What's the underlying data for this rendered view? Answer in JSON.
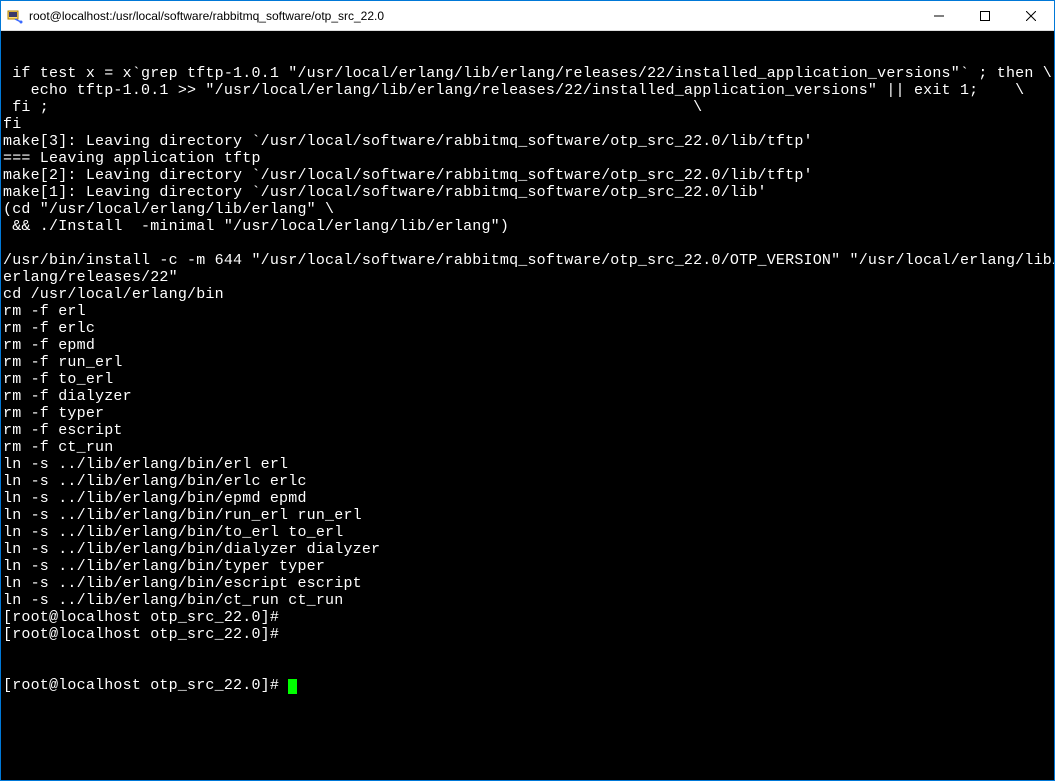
{
  "window": {
    "title": "root@localhost:/usr/local/software/rabbitmq_software/otp_src_22.0"
  },
  "terminal": {
    "lines": [
      " if test x = x`grep tftp-1.0.1 \"/usr/local/erlang/lib/erlang/releases/22/installed_application_versions\"` ; then \\",
      "   echo tftp-1.0.1 >> \"/usr/local/erlang/lib/erlang/releases/22/installed_application_versions\" || exit 1;    \\",
      " fi ;                                                                      \\",
      "fi",
      "make[3]: Leaving directory `/usr/local/software/rabbitmq_software/otp_src_22.0/lib/tftp'",
      "=== Leaving application tftp",
      "make[2]: Leaving directory `/usr/local/software/rabbitmq_software/otp_src_22.0/lib/tftp'",
      "make[1]: Leaving directory `/usr/local/software/rabbitmq_software/otp_src_22.0/lib'",
      "(cd \"/usr/local/erlang/lib/erlang\" \\",
      " && ./Install  -minimal \"/usr/local/erlang/lib/erlang\")",
      "",
      "/usr/bin/install -c -m 644 \"/usr/local/software/rabbitmq_software/otp_src_22.0/OTP_VERSION\" \"/usr/local/erlang/lib/erlang/releases/22\"",
      "cd /usr/local/erlang/bin",
      "rm -f erl",
      "rm -f erlc",
      "rm -f epmd",
      "rm -f run_erl",
      "rm -f to_erl",
      "rm -f dialyzer",
      "rm -f typer",
      "rm -f escript",
      "rm -f ct_run",
      "ln -s ../lib/erlang/bin/erl erl",
      "ln -s ../lib/erlang/bin/erlc erlc",
      "ln -s ../lib/erlang/bin/epmd epmd",
      "ln -s ../lib/erlang/bin/run_erl run_erl",
      "ln -s ../lib/erlang/bin/to_erl to_erl",
      "ln -s ../lib/erlang/bin/dialyzer dialyzer",
      "ln -s ../lib/erlang/bin/typer typer",
      "ln -s ../lib/erlang/bin/escript escript",
      "ln -s ../lib/erlang/bin/ct_run ct_run",
      "[root@localhost otp_src_22.0]# ",
      "[root@localhost otp_src_22.0]# "
    ],
    "prompt_line": "[root@localhost otp_src_22.0]# "
  }
}
